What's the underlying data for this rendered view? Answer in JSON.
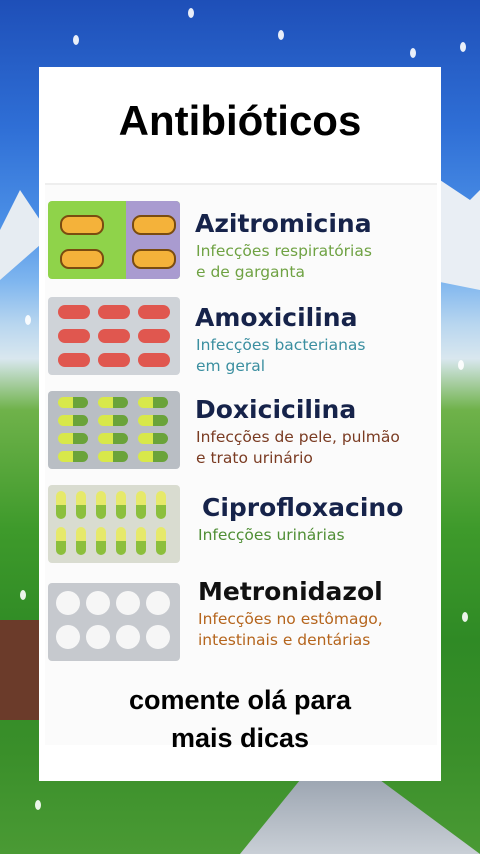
{
  "header": {
    "title": "Antibióticos"
  },
  "medicines": [
    {
      "name": "Azitromicina",
      "description": "Infecções respiratórias e de garganta",
      "line1": "Infecções respiratórias",
      "line2": "e de garganta",
      "color": "#6fa243"
    },
    {
      "name": "Amoxicilina",
      "description": "Infecções bacterianas em geral",
      "line1": "Infecções bacterianas",
      "line2": "em geral",
      "color": "#3b8fa0"
    },
    {
      "name": "Doxicicilina",
      "description": "Infecções de pele, pulmão e trato urinário",
      "line1": "Infecções de pele, pulmão",
      "line2": "e trato urinário",
      "color": "#7a3b22"
    },
    {
      "name": "Ciprofloxacino",
      "description": "Infecções urinárias",
      "line1": "Infecções urinárias",
      "line2": "",
      "color": "#4f8e35"
    },
    {
      "name": "Metronidazol",
      "description": "Infecções no estômago, intestinais e dentárias",
      "line1": "Infecções no estômago,",
      "line2": "intestinais e dentárias",
      "color": "#b5651d"
    }
  ],
  "footer": {
    "line1": "comente olá para",
    "line2": "mais dicas"
  },
  "colors": {
    "card": "#ffffff",
    "name": "#16234a"
  }
}
